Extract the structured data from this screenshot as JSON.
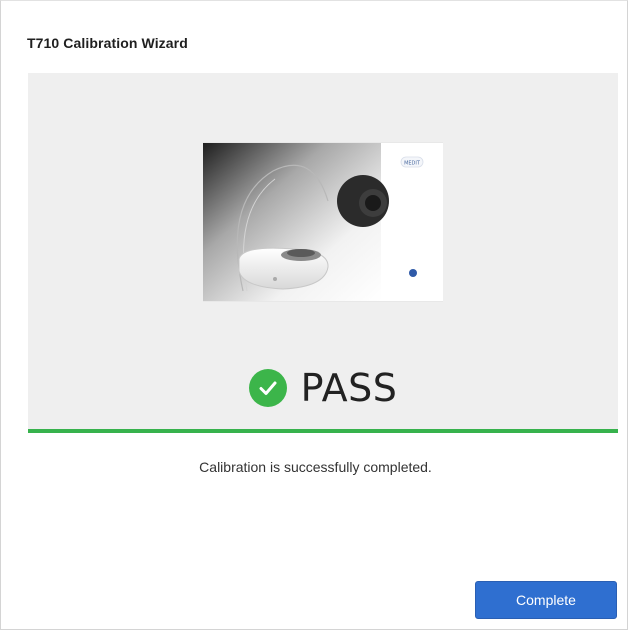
{
  "window": {
    "title": "T710 Calibration Wizard"
  },
  "device_image": {
    "logo_text": "MEDIT"
  },
  "result": {
    "status_label": "PASS",
    "status_icon": "check-circle-icon",
    "status_color": "#3cb54a",
    "progress_fraction": 1.0,
    "progress_color": "#37b24d"
  },
  "message": {
    "text": "Calibration is successfully completed."
  },
  "actions": {
    "complete_label": "Complete",
    "complete_color": "#2f6fd0"
  }
}
